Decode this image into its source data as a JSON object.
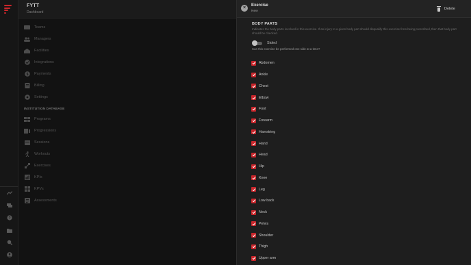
{
  "app": {
    "title": "FYTT",
    "subtitle": "Dashboard"
  },
  "nav": {
    "items": [
      {
        "label": "Teams",
        "icon": "teams-icon"
      },
      {
        "label": "Managers",
        "icon": "managers-icon"
      },
      {
        "label": "Facilities",
        "icon": "facilities-icon"
      },
      {
        "label": "Integrations",
        "icon": "integrations-icon"
      },
      {
        "label": "Payments",
        "icon": "payments-icon"
      },
      {
        "label": "Billing",
        "icon": "billing-icon"
      },
      {
        "label": "Settings",
        "icon": "settings-icon"
      }
    ],
    "section_heading": "INSTITUTION DATABASE",
    "database_items": [
      {
        "label": "Programs",
        "icon": "programs-icon"
      },
      {
        "label": "Progressions",
        "icon": "progressions-icon"
      },
      {
        "label": "Sessions",
        "icon": "sessions-icon"
      },
      {
        "label": "Workouts",
        "icon": "workouts-icon"
      },
      {
        "label": "Exercises",
        "icon": "exercises-icon"
      },
      {
        "label": "KPIs",
        "icon": "kpis-icon"
      },
      {
        "label": "KPVs",
        "icon": "kpvs-icon"
      },
      {
        "label": "Assessments",
        "icon": "assessments-icon"
      }
    ]
  },
  "rail": {
    "icons": [
      "trend-icon",
      "chat-icon",
      "help-icon",
      "folder-icon",
      "search-person-icon",
      "account-icon"
    ]
  },
  "panel": {
    "title": "Exercise",
    "subtitle": "New",
    "delete_label": "Delete",
    "section_title": "BODY PARTS",
    "section_desc": "Indicates the body parts involved in this exercise. If an injury to a given body part should disqualify this exercise from being prescribed, then that body part should be checked.",
    "sided_label": "Sided",
    "sided_checked": false,
    "sided_help": "Can this exercise be performed one side at a time?",
    "body_parts": [
      {
        "label": "Abdomen",
        "checked": true
      },
      {
        "label": "Ankle",
        "checked": true
      },
      {
        "label": "Chest",
        "checked": true
      },
      {
        "label": "Elbow",
        "checked": true
      },
      {
        "label": "Foot",
        "checked": true
      },
      {
        "label": "Forearm",
        "checked": true
      },
      {
        "label": "Hamstring",
        "checked": true
      },
      {
        "label": "Hand",
        "checked": true
      },
      {
        "label": "Head",
        "checked": true
      },
      {
        "label": "Hip",
        "checked": true
      },
      {
        "label": "Knee",
        "checked": true
      },
      {
        "label": "Leg",
        "checked": true
      },
      {
        "label": "Low back",
        "checked": true
      },
      {
        "label": "Neck",
        "checked": true
      },
      {
        "label": "Pelvis",
        "checked": true
      },
      {
        "label": "Shoulder",
        "checked": true
      },
      {
        "label": "Thigh",
        "checked": true
      },
      {
        "label": "Upper arm",
        "checked": true
      }
    ]
  },
  "colors": {
    "accent": "#c8262b",
    "panel_bg": "#1e1e1e",
    "nav_bg": "#121212"
  }
}
